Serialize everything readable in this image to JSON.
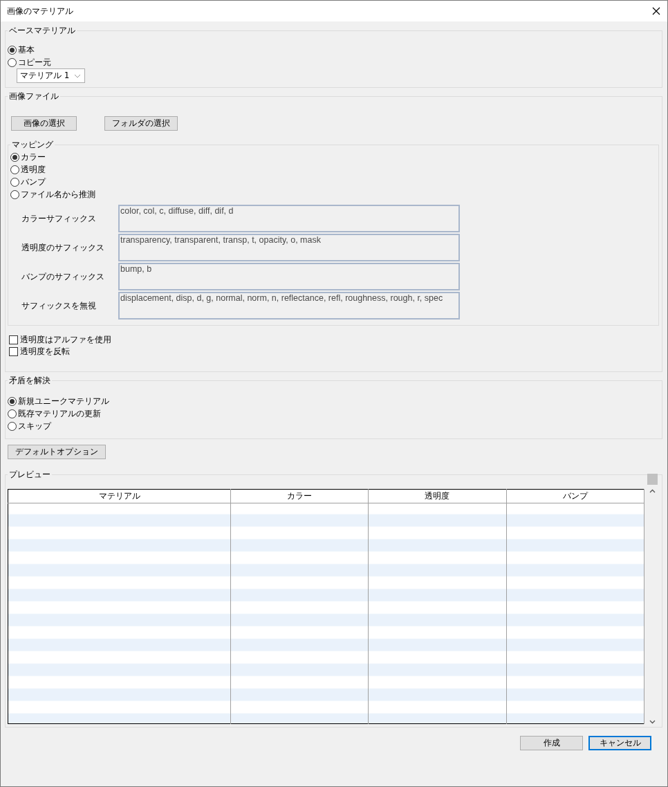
{
  "window": {
    "title": "画像のマテリアル"
  },
  "base_material": {
    "title": "ベースマテリアル",
    "options": [
      {
        "label": "基本",
        "selected": true
      },
      {
        "label": "コピー元",
        "selected": false
      }
    ],
    "dropdown": {
      "value": "マテリアル 1"
    }
  },
  "image_file": {
    "title": "画像ファイル",
    "buttons": [
      "画像の選択",
      "フォルダの選択"
    ],
    "mapping": {
      "title": "マッピング",
      "options": [
        {
          "label": "カラー",
          "selected": true
        },
        {
          "label": "透明度",
          "selected": false
        },
        {
          "label": "バンプ",
          "selected": false
        },
        {
          "label": "ファイル名から推測",
          "selected": false
        }
      ],
      "suffix_fields": [
        {
          "label": "カラーサフィックス",
          "value": "color, col, c, diffuse, diff, dif, d"
        },
        {
          "label": "透明度のサフィックス",
          "value": "transparency, transparent, transp, t, opacity, o, mask"
        },
        {
          "label": "バンプのサフィックス",
          "value": "bump, b"
        },
        {
          "label": "サフィックスを無視",
          "value": "displacement, disp, d, g, normal, norm, n, reflectance, refl, roughness, rough, r, spec"
        }
      ]
    },
    "checkboxes": [
      {
        "label": "透明度はアルファを使用",
        "checked": false
      },
      {
        "label": "透明度を反転",
        "checked": false
      }
    ]
  },
  "conflict": {
    "title": "矛盾を解決",
    "options": [
      {
        "label": "新規ユニークマテリアル",
        "selected": true
      },
      {
        "label": "既存マテリアルの更新",
        "selected": false
      },
      {
        "label": "スキップ",
        "selected": false
      }
    ]
  },
  "default_button": "デフォルトオプション",
  "preview": {
    "title": "プレビュー",
    "table": {
      "columns": [
        "マテリアル",
        "カラー",
        "透明度",
        "バンプ"
      ]
    }
  },
  "buttons": [
    {
      "label": "作成",
      "focused": false
    },
    {
      "label": "キャンセル",
      "focused": true
    }
  ]
}
